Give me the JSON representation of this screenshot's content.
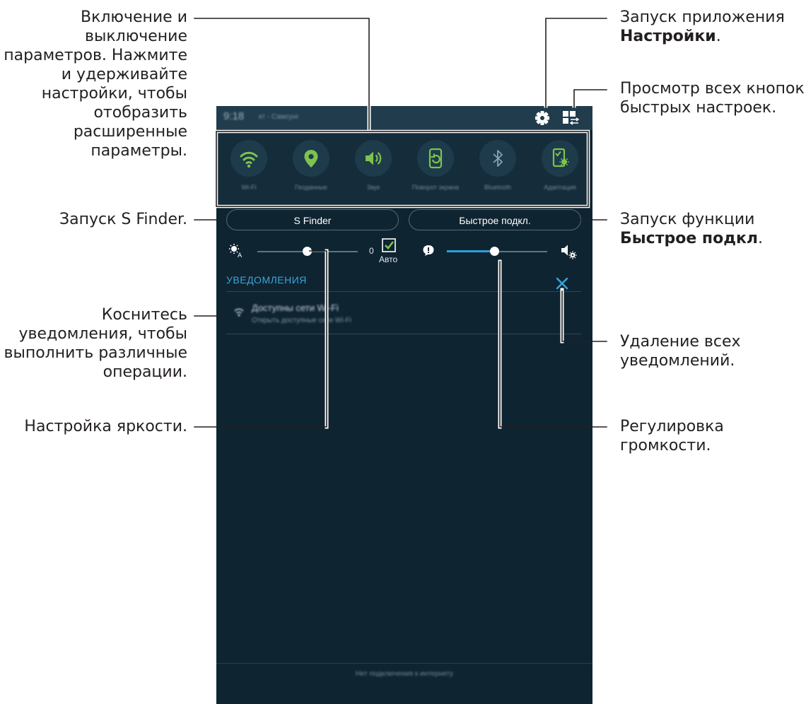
{
  "callouts": {
    "toggles": [
      "Включение и",
      "выключение",
      "параметров. Нажмите",
      "и удерживайте",
      "настройки, чтобы",
      "отобразить",
      "расширенные",
      "параметры."
    ],
    "settings": [
      "Запуск приложения",
      "Настройки",
      "."
    ],
    "quick_settings": [
      "Просмотр всех кнопок",
      "быстрых настроек."
    ],
    "s_finder": "Запуск S Finder.",
    "quick_connect": [
      "Запуск функции",
      "Быстрое подкл",
      "."
    ],
    "notification": [
      "Коснитесь",
      "уведомления, чтобы",
      "выполнить различные",
      "операции."
    ],
    "clear": [
      "Удаление всех",
      "уведомлений."
    ],
    "brightness": "Настройка яркости.",
    "volume": [
      "Регулировка",
      "громкости."
    ]
  },
  "status_bar": {
    "time": "9:18",
    "carrier": "кт - Самсунг"
  },
  "quick_toggles": [
    {
      "label": "Wi-Fi",
      "icon": "wifi-icon"
    },
    {
      "label": "Геоданные",
      "icon": "location-icon"
    },
    {
      "label": "Звук",
      "icon": "sound-icon"
    },
    {
      "label": "Поворот экрана",
      "icon": "rotate-icon"
    },
    {
      "label": "Bluetooth",
      "icon": "bluetooth-icon"
    },
    {
      "label": "Адаптация",
      "icon": "adapt-display-icon"
    }
  ],
  "buttons": {
    "s_finder": "S Finder",
    "quick_connect": "Быстрое подкл."
  },
  "brightness": {
    "value_label": "0",
    "auto_label": "Авто",
    "auto_checked": true,
    "level": 0.48
  },
  "volume": {
    "level": 0.47
  },
  "notifications": {
    "header": "УВЕДОМЛЕНИЯ",
    "items": [
      {
        "title": "Доступны сети Wi-Fi",
        "subtitle": "Открыть доступные сети Wi-Fi"
      }
    ]
  },
  "footer": "Нет подключения к интернету",
  "colors": {
    "accent": "#2c9fd9",
    "panel": "#0f2431",
    "toggle_on": "#7ec34b"
  }
}
